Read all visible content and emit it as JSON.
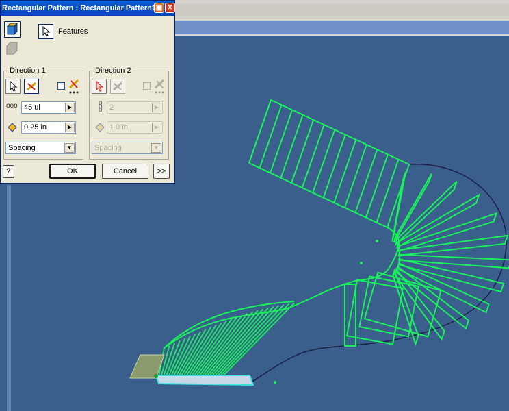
{
  "dialog": {
    "title": "Rectangular Pattern : Rectangular Pattern1",
    "features_label": "Features",
    "direction1": {
      "title": "Direction 1",
      "count_value": "45 ul",
      "spacing_value": "0.25 in",
      "method_value": "Spacing"
    },
    "direction2": {
      "title": "Direction 2",
      "count_value": "2",
      "spacing_value": "1.0 in",
      "method_value": "Spacing"
    },
    "ok_label": "OK",
    "cancel_label": "Cancel",
    "more_label": ">>",
    "help_label": "?"
  },
  "colors": {
    "viewport_bg": "#3a5f8c",
    "pattern_green": "#19f25a",
    "path_dark": "#1b1f48",
    "base_cyan": "#3fe3e0"
  }
}
